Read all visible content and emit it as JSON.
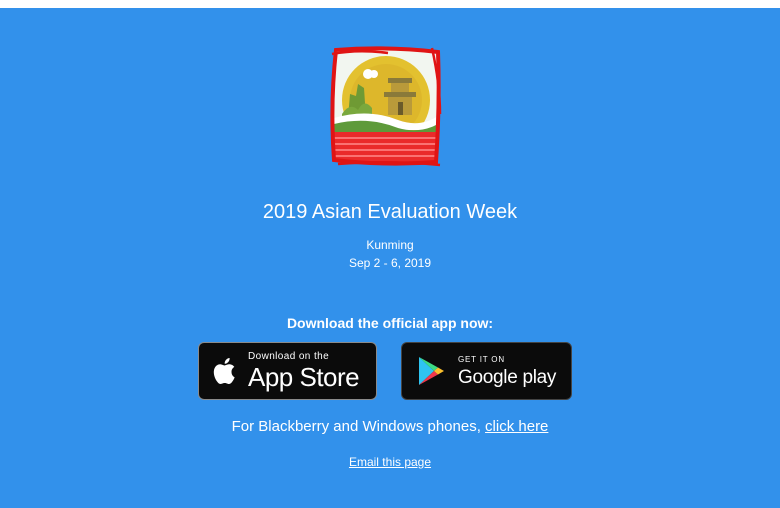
{
  "event": {
    "title": "2019 Asian Evaluation Week",
    "city": "Kunming",
    "dates": "Sep 2 - 6, 2019"
  },
  "download": {
    "heading": "Download the official app now:",
    "app_store": {
      "small": "Download on the",
      "big": "App Store",
      "icon": "apple-icon"
    },
    "google_play": {
      "small": "GET IT ON",
      "big": "Google play",
      "icon": "google-play-icon"
    }
  },
  "other_phones": {
    "text": "For Blackberry and Windows phones, ",
    "link": "click here"
  },
  "email_link": "Email this page",
  "colors": {
    "background": "#3291eb",
    "text": "#ffffff",
    "badge": "#0b0b0b"
  }
}
